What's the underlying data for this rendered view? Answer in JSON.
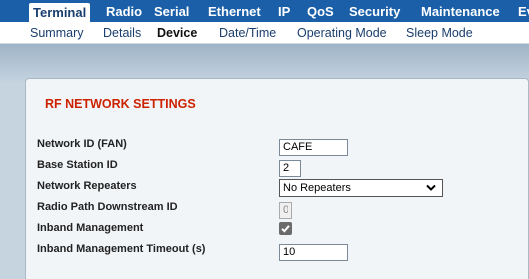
{
  "top_tabs": [
    {
      "label": "Terminal",
      "active": true
    },
    {
      "label": "Radio"
    },
    {
      "label": "Serial"
    },
    {
      "label": "Ethernet"
    },
    {
      "label": "IP"
    },
    {
      "label": "QoS"
    },
    {
      "label": "Security"
    },
    {
      "label": "Maintenance"
    },
    {
      "label": "Ev"
    }
  ],
  "sub_tabs": [
    {
      "label": "Summary"
    },
    {
      "label": "Details"
    },
    {
      "label": "Device",
      "active": true
    },
    {
      "label": "Date/Time"
    },
    {
      "label": "Operating Mode"
    },
    {
      "label": "Sleep Mode"
    }
  ],
  "section": {
    "title": "RF NETWORK SETTINGS"
  },
  "fields": {
    "network_id": {
      "label": "Network ID (FAN)",
      "value": "CAFE"
    },
    "base_station_id": {
      "label": "Base Station ID",
      "value": "2"
    },
    "network_repeaters": {
      "label": "Network Repeaters",
      "selected": "No Repeaters"
    },
    "radio_path_downstream_id": {
      "label": "Radio Path Downstream ID",
      "value": "0"
    },
    "inband_management": {
      "label": "Inband Management",
      "checked": true
    },
    "inband_management_timeout": {
      "label": "Inband Management Timeout (s)",
      "value": "10"
    }
  },
  "colors": {
    "nav_blue": "#1a5fa8",
    "title_red": "#cc2200",
    "panel_bg": "#f2f5f8",
    "page_bg": "#c6d4e0"
  }
}
